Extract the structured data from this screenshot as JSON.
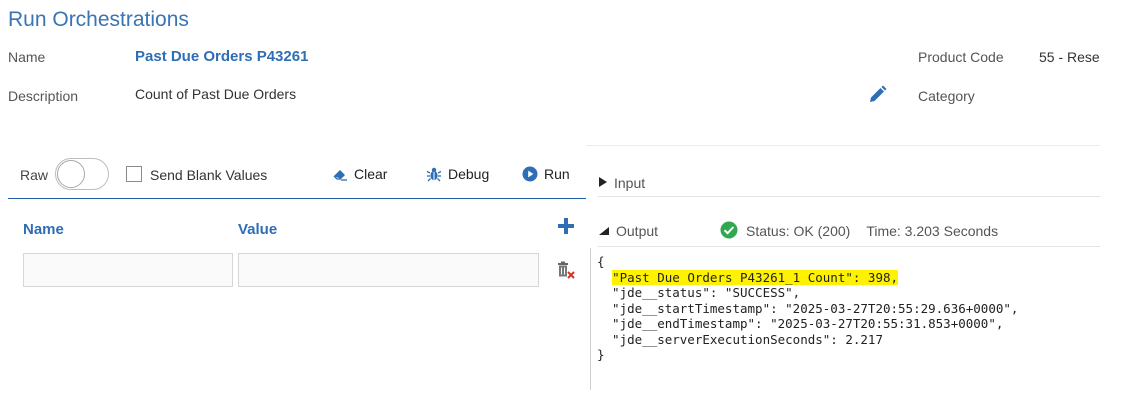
{
  "page": {
    "title": "Run Orchestrations"
  },
  "header": {
    "name_label": "Name",
    "name_value": "Past Due Orders P43261",
    "description_label": "Description",
    "description_value": "Count of Past Due Orders",
    "product_code_label": "Product Code",
    "product_code_value": "55 - Rese",
    "category_label": "Category"
  },
  "toolbar": {
    "raw_label": "Raw",
    "raw_toggle_on": false,
    "send_blank_label": "Send Blank Values",
    "send_blank_checked": false,
    "clear_label": "Clear",
    "debug_label": "Debug",
    "run_label": "Run"
  },
  "inputs_table": {
    "columns": [
      "Name",
      "Value"
    ],
    "rows": [
      {
        "name": "",
        "value": ""
      }
    ]
  },
  "right_panel": {
    "input_label": "Input",
    "input_expanded": false,
    "output_label": "Output",
    "output_expanded": true,
    "status_text": "Status: OK (200)",
    "time_text": "Time: 3.203 Seconds",
    "json_lines": [
      "{",
      "  \"Past Due Orders P43261_1 Count\": 398,",
      "  \"jde__status\": \"SUCCESS\",",
      "  \"jde__startTimestamp\": \"2025-03-27T20:55:29.636+0000\",",
      "  \"jde__endTimestamp\": \"2025-03-27T20:55:31.853+0000\",",
      "  \"jde__serverExecutionSeconds\": 2.217",
      "}"
    ],
    "highlighted_text": "\"Past Due Orders P43261_1 Count\": 398,"
  },
  "colors": {
    "accent": "#2f6db5",
    "title": "#3a74b3",
    "success": "#2fa84f",
    "highlight": "#fff200",
    "delete": "#d9322b"
  },
  "icons": {
    "edit": "pencil-icon",
    "clear": "eraser-icon",
    "debug": "bug-icon",
    "run": "play-circle-icon",
    "add": "plus-icon",
    "delete_row": "delete-row-icon",
    "status_ok": "check-circle-icon",
    "expand_input": "triangle-right-icon",
    "collapse_output": "triangle-down-icon"
  }
}
